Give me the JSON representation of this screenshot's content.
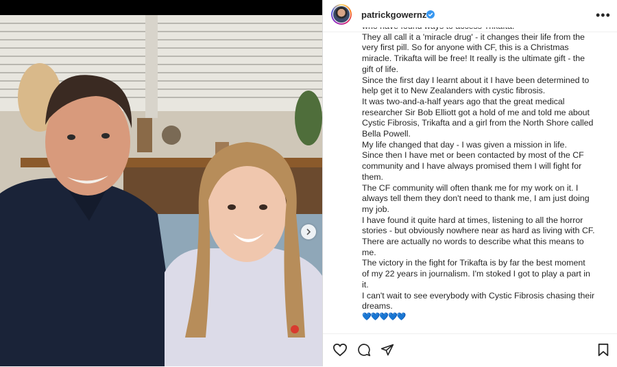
{
  "post": {
    "username": "patrickgowernz",
    "caption_lines": [
      "who have found ways to access Trikafta.",
      "They all call it a 'miracle drug' - it changes their life from the",
      "very first pill. So for anyone with CF, this is a Christmas",
      "miracle. Trikafta will be free! It really is the ultimate gift - the",
      "gift of life.",
      "Since the first day I learnt about it I have been determined to",
      "help get it to New Zealanders with cystic fibrosis.",
      "It was two-and-a-half years ago that the great medical",
      "researcher Sir Bob Elliott got a hold of me and told me about",
      "Cystic Fibrosis, Trikafta and a girl from the North Shore called",
      "Bella Powell.",
      "My life changed that day - I was given a mission in life.",
      "Since then I have met or been contacted by most of the CF",
      "community and I have always promised them I will fight for",
      "them.",
      "The CF community will often thank me for my work on it. I",
      "always tell them they don't need to thank me, I am just doing",
      "my job.",
      "I have found it quite hard at times, listening to all the horror",
      "stories - but obviously nowhere near as hard as living with CF.",
      "There are actually no words to describe what this means to",
      "me.",
      "The victory in the fight for Trikafta is by far the best moment",
      "of my 22 years in journalism. I'm stoked I got to play a part in",
      "it.",
      "I can't wait to see everybody with Cystic Fibrosis chasing their",
      "dreams."
    ],
    "emoji_line": "💙💙💙💙💙"
  },
  "colors": {
    "verified": "#3897f0",
    "text": "#262626",
    "divider": "#efefef"
  }
}
